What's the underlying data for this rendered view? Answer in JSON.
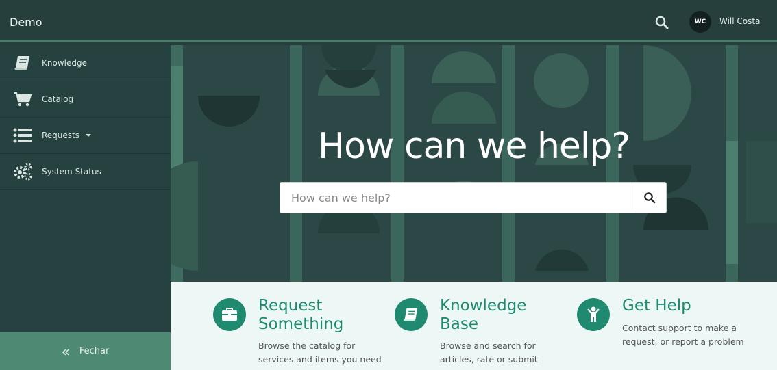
{
  "header": {
    "brand": "Demo",
    "user_initials": "WC",
    "user_name": "Will Costa",
    "search_icon": "search-icon"
  },
  "sidebar": {
    "items": [
      {
        "label": "Knowledge",
        "icon": "book-icon"
      },
      {
        "label": "Catalog",
        "icon": "cart-icon"
      },
      {
        "label": "Requests",
        "icon": "list-icon",
        "has_dropdown": true
      },
      {
        "label": "System Status",
        "icon": "gears-icon"
      }
    ],
    "close_label": "Fechar"
  },
  "hero": {
    "title": "How can we help?",
    "search_placeholder": "How can we help?"
  },
  "cards": [
    {
      "title_line1": "Request",
      "title_line2": "Something",
      "desc_line1": "Browse the catalog for",
      "desc_line2": "services and items you need",
      "icon": "briefcase-icon"
    },
    {
      "title_line1": "Knowledge",
      "title_line2": "Base",
      "desc_line1": "Browse and search for",
      "desc_line2": "articles, rate or submit",
      "icon": "book-icon"
    },
    {
      "title_line1": "Get Help",
      "desc_line1": "Contact support to make a",
      "desc_line2": "request, or report a problem",
      "icon": "person-icon"
    }
  ],
  "colors": {
    "accent": "#1f8a6f",
    "header_bg": "#263f3d",
    "sidebar_bg": "#264240",
    "close_bg": "#4e8a73",
    "cards_bg": "#edf7f5"
  }
}
